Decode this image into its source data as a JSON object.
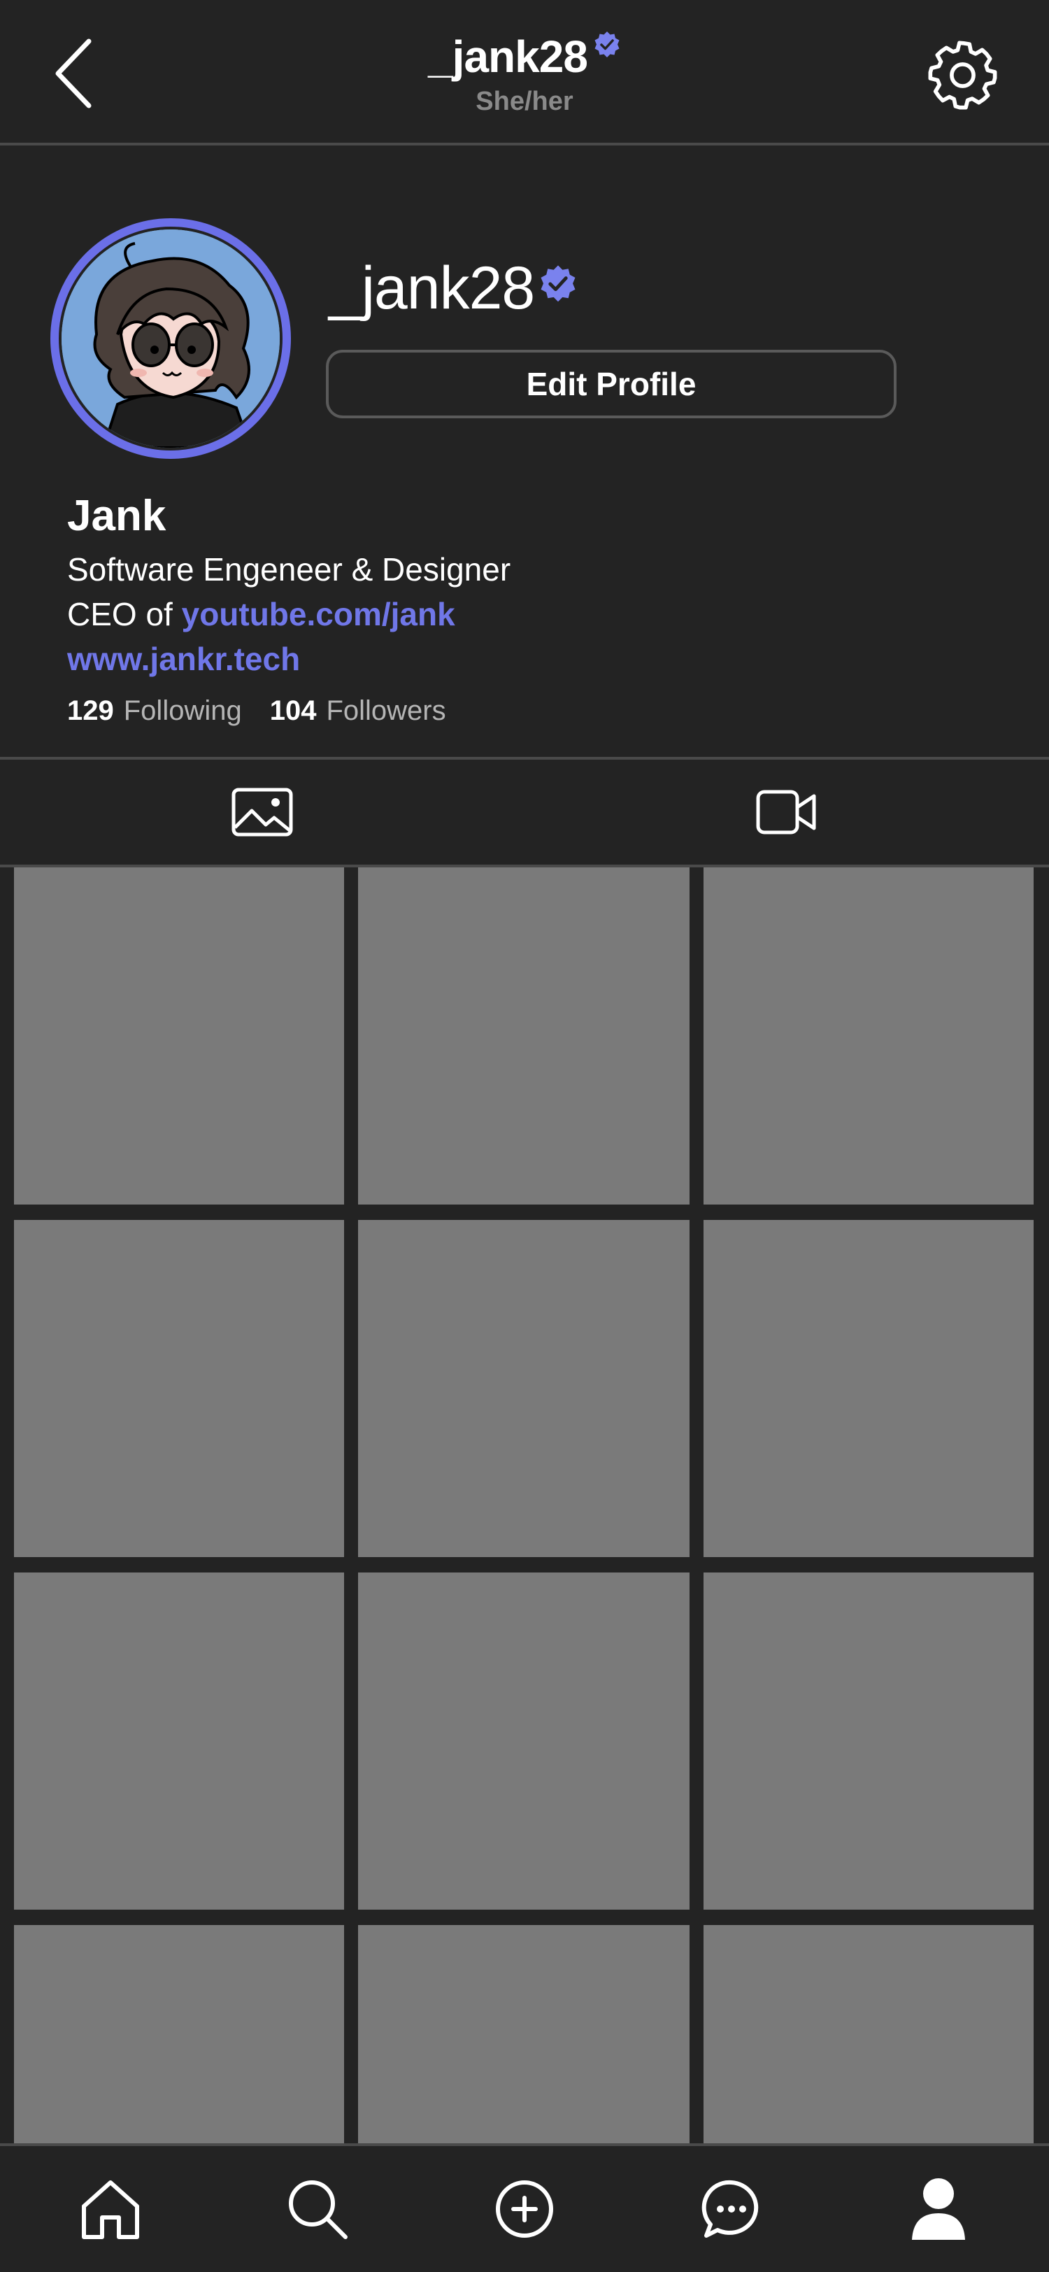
{
  "header": {
    "title": "_jank28",
    "pronouns": "She/her"
  },
  "profile": {
    "username": "_jank28",
    "verified": true,
    "edit_button": "Edit Profile",
    "display_name": "Jank",
    "bio_line1": "Software Engeneer & Designer",
    "bio_line2_prefix": "CEO of ",
    "bio_line2_link": "youtube.com/jank",
    "website": "www.jankr.tech",
    "following_count": "129",
    "following_label": "Following",
    "followers_count": "104",
    "followers_label": "Followers"
  },
  "tabs": [
    {
      "icon": "image-icon"
    },
    {
      "icon": "video-camera-icon"
    }
  ],
  "bottom_nav": [
    {
      "icon": "home-icon"
    },
    {
      "icon": "search-icon"
    },
    {
      "icon": "add-circle-icon"
    },
    {
      "icon": "chat-icon"
    },
    {
      "icon": "profile-icon"
    }
  ],
  "colors": {
    "background": "#232323",
    "accent": "#6b6fe8",
    "link": "#7077e8",
    "grid_placeholder": "#7a7a7a",
    "secondary_text": "#8a8a8a"
  }
}
